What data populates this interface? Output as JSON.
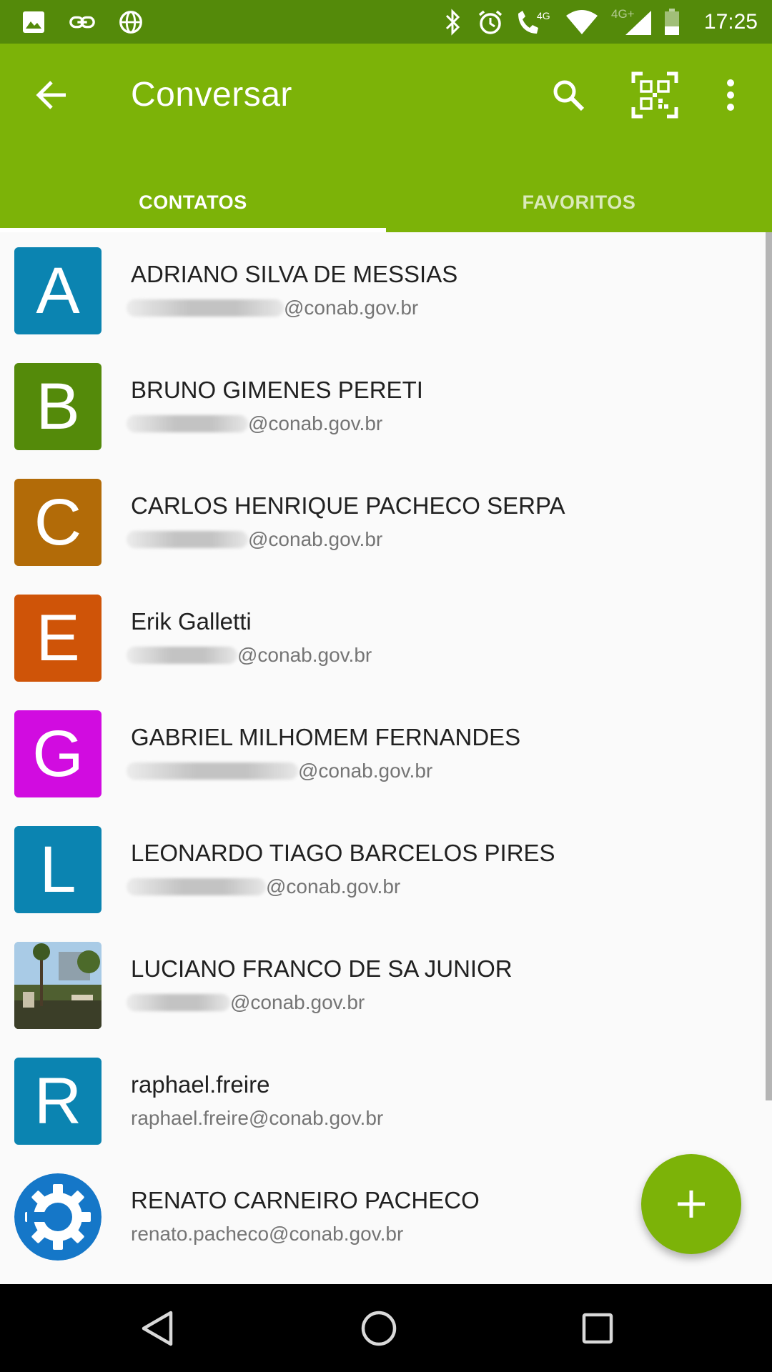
{
  "status_bar": {
    "time": "17:25",
    "network_label": "4G",
    "network_label_2": "4G+",
    "left_icons": [
      "image-icon",
      "link-icon",
      "sync-globe-icon"
    ],
    "right_icons": [
      "bluetooth-icon",
      "alarm-icon",
      "volte-call-icon",
      "wifi-icon",
      "signal-icon",
      "battery-icon"
    ]
  },
  "app_bar": {
    "title": "Conversar",
    "actions": [
      "search-icon",
      "qr-code-icon",
      "more-vert-icon"
    ],
    "background": "#7cb308"
  },
  "tabs": [
    {
      "label": "CONTATOS",
      "active": true
    },
    {
      "label": "FAVORITOS",
      "active": false
    }
  ],
  "contacts": [
    {
      "name": "ADRIANO SILVA DE MESSIAS",
      "email": "@conab.gov.br",
      "email_redacted": true,
      "avatar_letter": "A",
      "avatar_color": "#0b84b1"
    },
    {
      "name": "BRUNO GIMENES PERETI",
      "email": "@conab.gov.br",
      "email_redacted": true,
      "avatar_letter": "B",
      "avatar_color": "#548a0a"
    },
    {
      "name": "CARLOS HENRIQUE PACHECO SERPA",
      "email": "@conab.gov.br",
      "email_redacted": true,
      "avatar_letter": "C",
      "avatar_color": "#b26b08"
    },
    {
      "name": "Erik Galletti",
      "email": "@conab.gov.br",
      "email_redacted": true,
      "avatar_letter": "E",
      "avatar_color": "#cf5408"
    },
    {
      "name": "GABRIEL MILHOMEM FERNANDES",
      "email": "@conab.gov.br",
      "email_redacted": true,
      "avatar_letter": "G",
      "avatar_color": "#d10ce0"
    },
    {
      "name": "LEONARDO TIAGO BARCELOS PIRES",
      "email": "@conab.gov.br",
      "email_redacted": true,
      "avatar_letter": "L",
      "avatar_color": "#0b84b1"
    },
    {
      "name": "LUCIANO FRANCO DE SA JUNIOR",
      "email": "@conab.gov.br",
      "email_redacted": true,
      "avatar_letter": "",
      "avatar_color": "#6a7a5a"
    },
    {
      "name": "raphael.freire",
      "email": "raphael.freire@conab.gov.br",
      "email_redacted": false,
      "avatar_letter": "R",
      "avatar_color": "#0b84b1"
    },
    {
      "name": "RENATO CARNEIRO PACHECO",
      "email": "renato.pacheco@conab.gov.br",
      "email_redacted": false,
      "avatar_letter": "",
      "avatar_color": "#1577c8"
    }
  ],
  "fab": {
    "icon": "plus-icon",
    "color": "#7cb308"
  },
  "nav_bar": {
    "buttons": [
      "back-triangle-icon",
      "home-circle-icon",
      "recents-square-icon"
    ]
  }
}
